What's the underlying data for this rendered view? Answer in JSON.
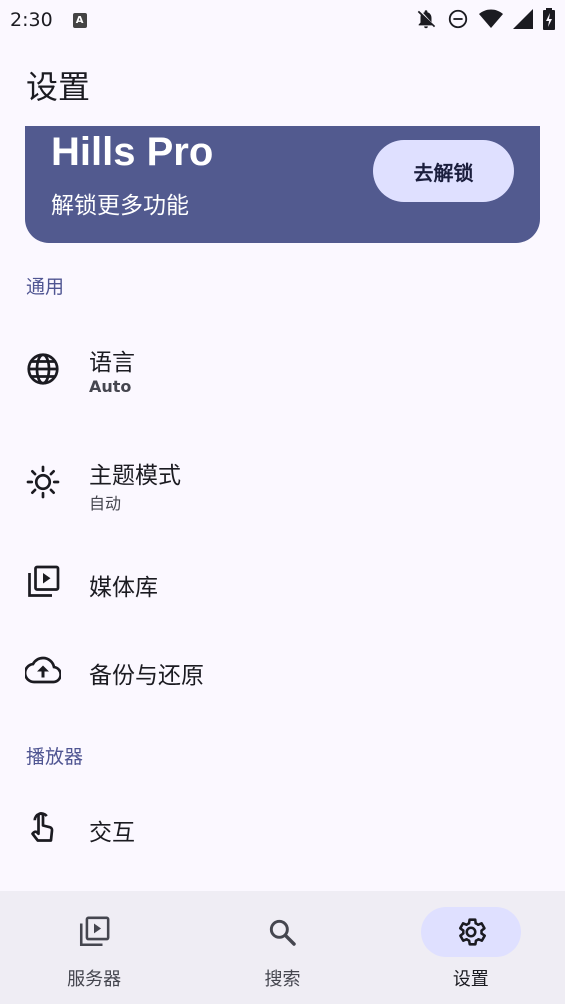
{
  "status_bar": {
    "time": "2:30",
    "app_icon_letter": "A"
  },
  "page": {
    "title": "设置"
  },
  "pro_card": {
    "title": "Hills Pro",
    "subtitle": "解锁更多功能",
    "unlock_label": "去解锁"
  },
  "sections": [
    {
      "header": "通用",
      "items": [
        {
          "label": "语言",
          "value": "Auto",
          "icon": "globe-icon"
        },
        {
          "label": "主题模式",
          "value": "自动",
          "icon": "brightness-icon"
        },
        {
          "label": "媒体库",
          "icon": "video-library-icon"
        },
        {
          "label": "备份与还原",
          "icon": "cloud-upload-icon"
        }
      ]
    },
    {
      "header": "播放器",
      "items": [
        {
          "label": "交互",
          "icon": "touch-icon"
        }
      ]
    }
  ],
  "bottom_nav": {
    "items": [
      {
        "label": "服务器",
        "icon": "video-library-icon",
        "active": false
      },
      {
        "label": "搜索",
        "icon": "search-icon",
        "active": false
      },
      {
        "label": "设置",
        "icon": "gear-icon",
        "active": true
      }
    ]
  },
  "colors": {
    "background": "#fbf8ff",
    "card": "#525a8f",
    "accent_container": "#dfe0ff",
    "section_header": "#4f5592",
    "nav_background": "#efedf4"
  }
}
